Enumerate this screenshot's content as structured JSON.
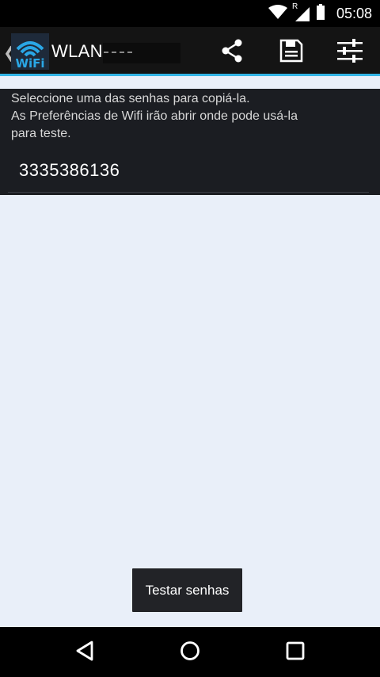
{
  "status_bar": {
    "time": "05:08",
    "icons": [
      "wifi-icon",
      "cell-signal-roaming-icon",
      "battery-icon"
    ],
    "roaming_label": "R"
  },
  "action_bar": {
    "title": "WLAN-",
    "logo_text": "WiFi",
    "actions": [
      "share-icon",
      "save-icon",
      "settings-sliders-icon"
    ],
    "accent_color": "#33b5e5"
  },
  "main": {
    "instructions_line1": "Seleccione uma das senhas para copiá-la.",
    "instructions_line2": "As Preferências de Wifi irão abrir onde pode usá-la",
    "instructions_line3": "para teste.",
    "passwords": [
      "3335386136"
    ]
  },
  "toast": {
    "text": "Testar senhas"
  },
  "nav_bar": {
    "buttons": [
      "back-icon",
      "home-icon",
      "recents-icon"
    ]
  }
}
